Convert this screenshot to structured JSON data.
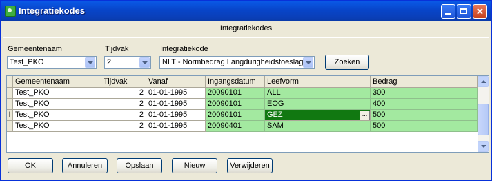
{
  "window": {
    "title": "Integratiekodes"
  },
  "header": {
    "label": "Integratiekodes"
  },
  "filters": {
    "gemeentenaam": {
      "label": "Gemeentenaam",
      "value": "Test_PKO"
    },
    "tijdvak": {
      "label": "Tijdvak",
      "value": "2"
    },
    "integratiekode": {
      "label": "Integratiekode",
      "value": "NLT - Normbedrag Langdurigheidstoeslag"
    },
    "zoeken_label": "Zoeken"
  },
  "table": {
    "columns": [
      "Gemeentenaam",
      "Tijdvak",
      "Vanaf",
      "Ingangsdatum",
      "Leefvorm",
      "Bedrag"
    ],
    "current_row_marker": "I",
    "ellipsis_label": "...",
    "rows": [
      {
        "gemeentenaam": "Test_PKO",
        "tijdvak": "2",
        "vanaf": "01-01-1995",
        "ingangsdatum": "20090101",
        "leefvorm": "ALL",
        "bedrag": "300"
      },
      {
        "gemeentenaam": "Test_PKO",
        "tijdvak": "2",
        "vanaf": "01-01-1995",
        "ingangsdatum": "20090101",
        "leefvorm": "EOG",
        "bedrag": "400"
      },
      {
        "gemeentenaam": "Test_PKO",
        "tijdvak": "2",
        "vanaf": "01-01-1995",
        "ingangsdatum": "20090101",
        "leefvorm": "GEZ",
        "bedrag": "500"
      },
      {
        "gemeentenaam": "Test_PKO",
        "tijdvak": "2",
        "vanaf": "01-01-1995",
        "ingangsdatum": "20090401",
        "leefvorm": "SAM",
        "bedrag": "500"
      }
    ]
  },
  "buttons": {
    "ok": "OK",
    "annuleren": "Annuleren",
    "opslaan": "Opslaan",
    "nieuw": "Nieuw",
    "verwijderen": "Verwijderen"
  },
  "colors": {
    "titlebar": "#0845c9",
    "editable_cell": "#a3e9a0",
    "selected_cell": "#117811"
  }
}
